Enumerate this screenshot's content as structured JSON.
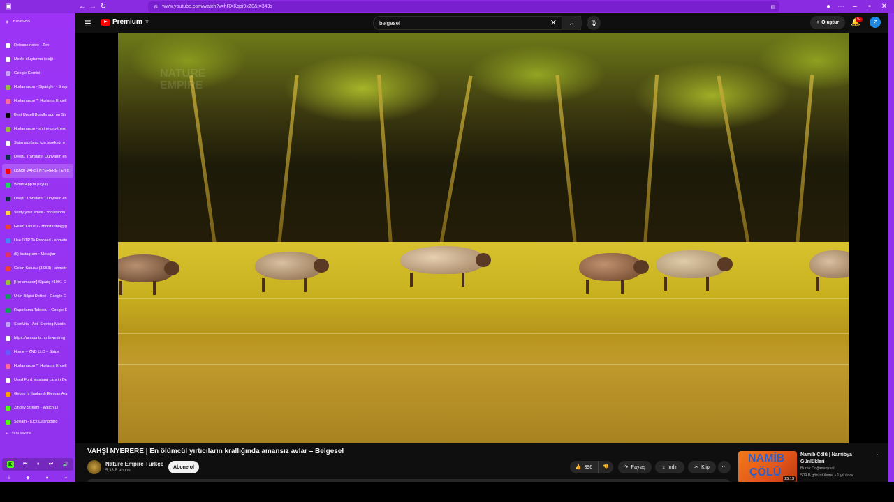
{
  "browser": {
    "url": "www.youtube.com/watch?v=hRXKqqi9xZ0&t=349s"
  },
  "sidebar": {
    "workspace": "Business",
    "tabs": [
      {
        "label": "Release notes - Zen"
      },
      {
        "label": "Model oluşturma isteği"
      },
      {
        "label": "Google Gemini"
      },
      {
        "label": "Horlamason - Siparişler · Shop"
      },
      {
        "label": "Horlamason™ Horlama Engell"
      },
      {
        "label": "Best Upsell Bundle app on Sh"
      },
      {
        "label": "Horlamason - shrine-pro-them"
      },
      {
        "label": "Satın aldığınız için teşekkür e"
      },
      {
        "label": "DeepL Translate: Dünyanın en"
      },
      {
        "label": "(1998) VAHŞİ NYERERE | En ö"
      },
      {
        "label": "WhatsApp'ta paylaş"
      },
      {
        "label": "DeepL Translate: Dünyanın en"
      },
      {
        "label": "Verify your email - zndistanbu"
      },
      {
        "label": "Gelen Kutusu - zndistanbul@g"
      },
      {
        "label": "Use OTP To Proceed - ahmetn"
      },
      {
        "label": "(8) Instagram • Mesajlar"
      },
      {
        "label": "Gelen Kutusu (3.953) - ahmetr"
      },
      {
        "label": "[Horlamason] Sipariş #1001 E"
      },
      {
        "label": "Ürün Bilgisi Defteri - Google E"
      },
      {
        "label": "Raporlama Tablosu - Google E"
      },
      {
        "label": "SomVita - Anti-Snoring Mouth"
      },
      {
        "label": "https://accounts.northwestreg"
      },
      {
        "label": "Home – ZND LLC – Stripe"
      },
      {
        "label": "Horlamason™ Horlama Engell"
      },
      {
        "label": "Used Ford Mustang cars in De"
      },
      {
        "label": "Gebze İş İlanları & Eleman Ara"
      },
      {
        "label": "Zindev Stream - Watch Li"
      },
      {
        "label": "Stream - Kick Dashboard"
      }
    ],
    "new_tab": "Yeni sekme"
  },
  "youtube": {
    "logo_text": "Premium",
    "logo_sup": "TR",
    "search_value": "belgesel",
    "create_label": "Oluştur",
    "notif_badge": "9+",
    "avatar_letter": "Z"
  },
  "video": {
    "watermark": "NATURE EMPIRE",
    "title": "VAHŞİ NYERERE | En ölümcül yırtıcıların krallığında amansız avlar – Belgesel",
    "channel": "Nature Empire Türkçe",
    "subscribers": "5,33 B abone",
    "subscribe_label": "Abone ol",
    "likes": "396",
    "share_label": "Paylaş",
    "download_label": "İndir",
    "clip_label": "Klip"
  },
  "recommendation": {
    "title": "Namib Çölü | Namibya Günlükleri",
    "channel": "Burak Doğansoysal",
    "meta": "509 B görüntüleme • 1 yıl önce",
    "duration": "25:13",
    "thumb_line1": "NAMİB",
    "thumb_line2": "ÇÖLÜ"
  }
}
